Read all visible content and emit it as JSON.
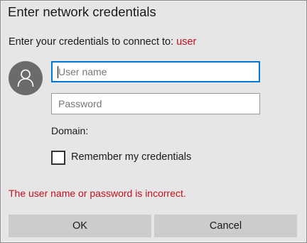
{
  "dialog": {
    "title": "Enter network credentials",
    "prompt": "Enter your credentials to connect to:",
    "target": "user",
    "avatar_icon": "user-icon",
    "username": {
      "value": "",
      "placeholder": "User name"
    },
    "password": {
      "value": "",
      "placeholder": "Password"
    },
    "domain_label": "Domain:",
    "remember": {
      "label": "Remember my credentials",
      "checked": false
    },
    "error": "The user name or password is incorrect.",
    "buttons": {
      "ok": "OK",
      "cancel": "Cancel"
    }
  },
  "colors": {
    "accent": "#0078d7",
    "error": "#c50f1f",
    "background": "#e6e6e6",
    "button": "#cccccc",
    "avatar": "#6b6b6b"
  }
}
